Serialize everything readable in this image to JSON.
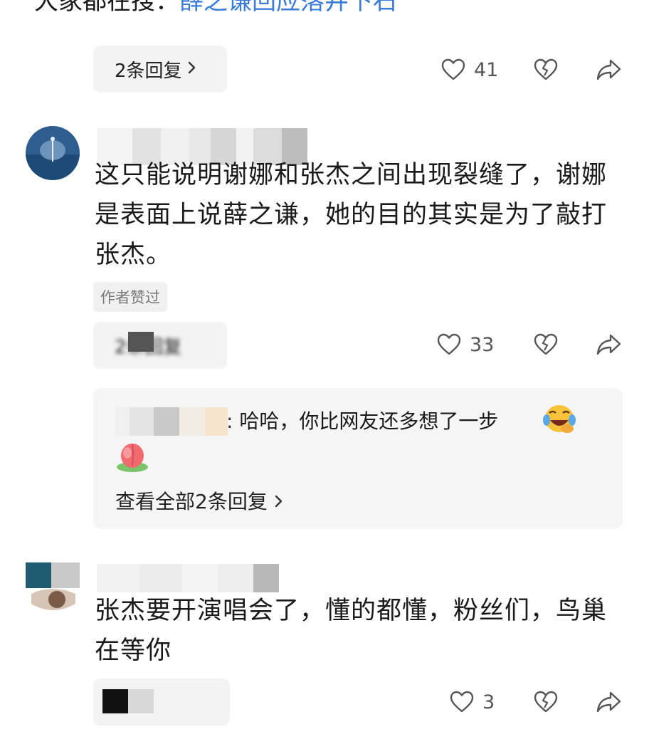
{
  "search": {
    "prefix": "大家都在搜：",
    "query": "薛之谦回应落井下石",
    "icon": "search-icon"
  },
  "first_thread": {
    "replies_label": "2条回复",
    "likes": "41"
  },
  "comment1": {
    "text": "这只能说明谢娜和张杰之间出现裂缝了，谢娜是表面上说薛之谦，她的目的其实是为了敲打张杰。",
    "author_tag": "作者赞过",
    "replies_label": "2条回复",
    "likes": "33",
    "sub_reply": {
      "text": "哈哈，你比网友还多想了一步",
      "view_all": "查看全部2条回复"
    }
  },
  "comment2": {
    "text": "张杰要开演唱会了，懂的都懂，粉丝们，鸟巢在等你",
    "likes": "3"
  },
  "colors": {
    "link": "#3b7bd9",
    "pill_bg": "#f3f3f3",
    "text": "#1a1a1a",
    "muted": "#555555"
  }
}
